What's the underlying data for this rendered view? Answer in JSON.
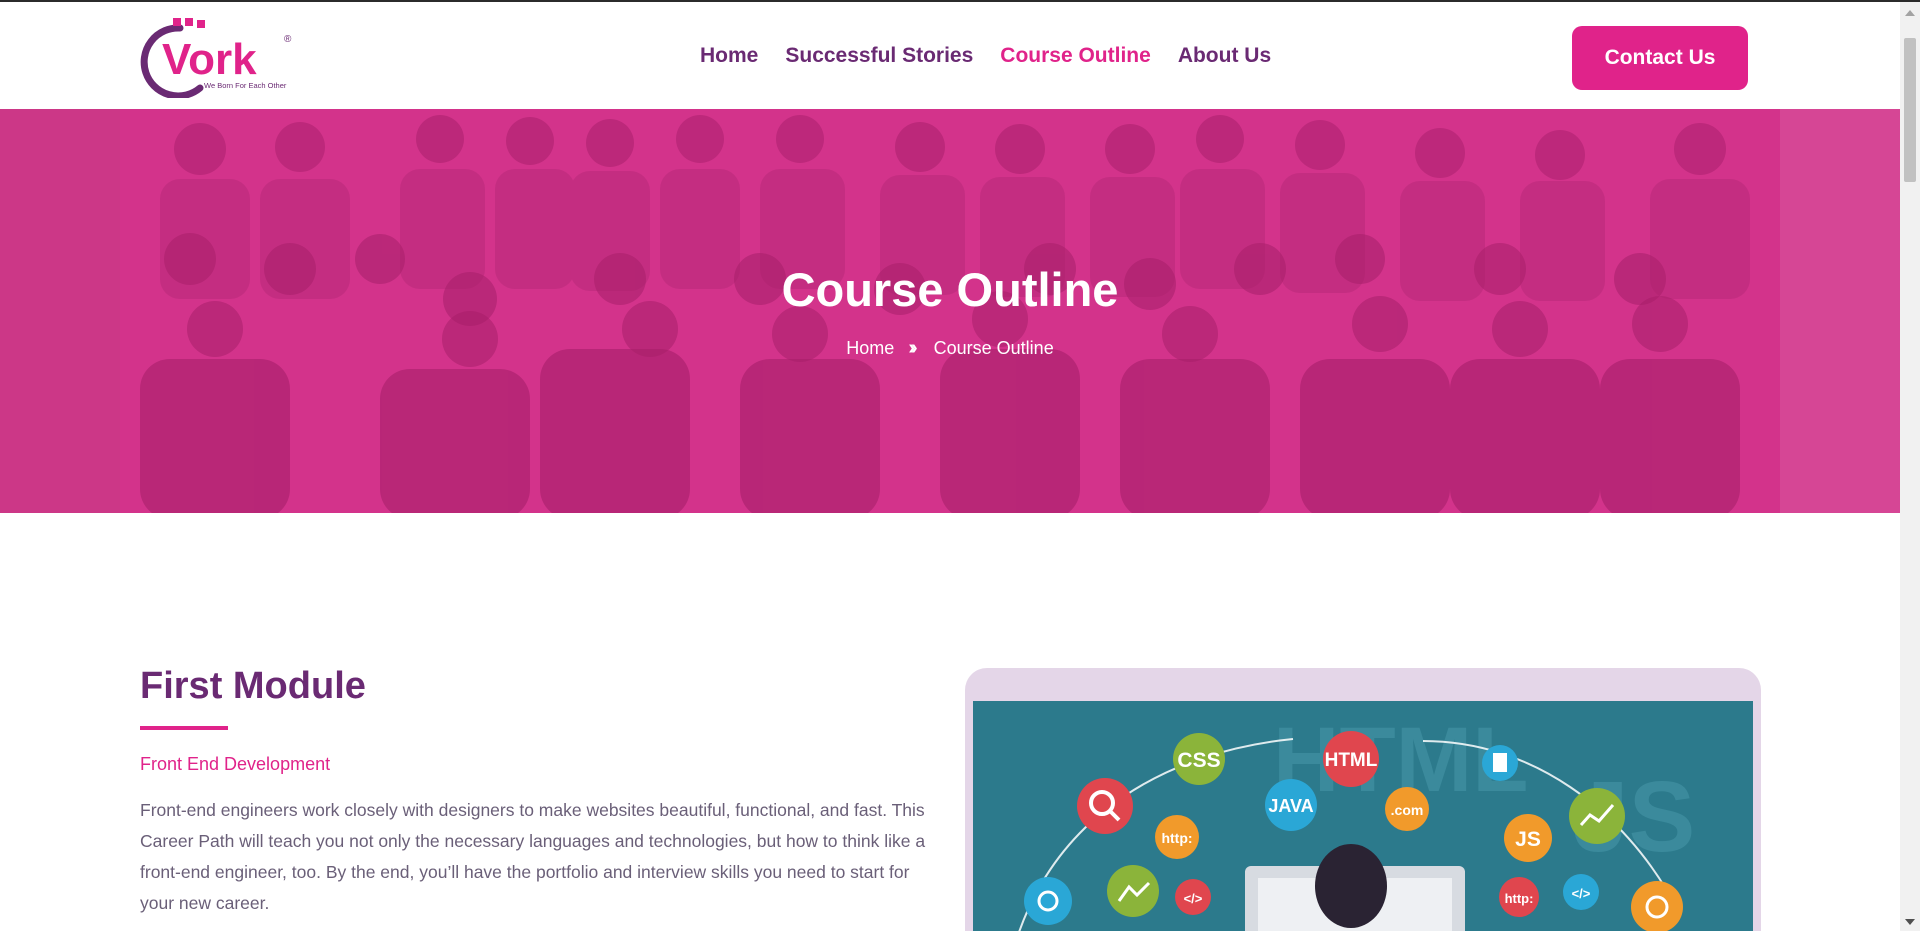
{
  "brand": {
    "logo_text": "Vork",
    "tagline": "We Born For Each Other",
    "registered": "®",
    "primary_color": "#e0238a",
    "secondary_color": "#6a2a73"
  },
  "nav": {
    "items": [
      {
        "label": "Home"
      },
      {
        "label": "Successful Stories"
      },
      {
        "label": "Course Outline",
        "active": true
      },
      {
        "label": "About Us"
      }
    ],
    "contact_label": "Contact Us"
  },
  "hero": {
    "title": "Course Outline",
    "breadcrumb": {
      "home": "Home",
      "separator_icon": "double-chevron-right-icon",
      "current": "Course Outline"
    }
  },
  "module": {
    "title": "First Module",
    "subtitle": "Front End Development",
    "description": "Front-end engineers work closely with designers to make websites beautiful, functional, and fast. This Career Path will teach you not only the necessary languages and technologies, but how to think like a front-end engineer, too. By the end, you’ll have the portfolio and interview skills you need to start for your new career."
  },
  "illustration": {
    "labels": [
      "CSS",
      "HTML",
      "JAVA",
      ".com",
      "http:",
      "JS",
      "http:",
      "</>",
      "</>"
    ],
    "background_words": [
      "HTML",
      "JS"
    ]
  }
}
